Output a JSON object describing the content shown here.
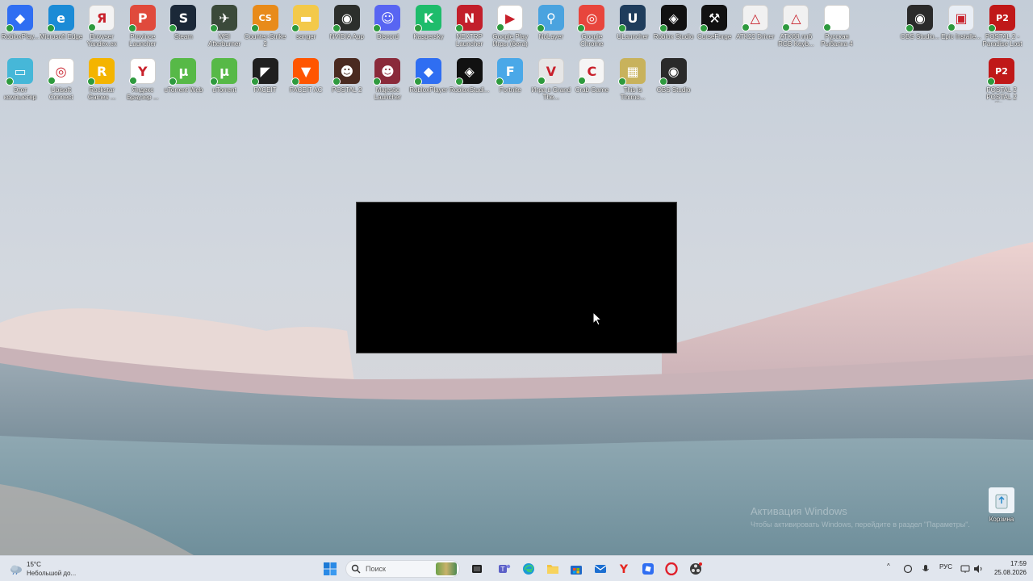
{
  "desktop": {
    "row1": [
      {
        "label": "RobloxPlay...",
        "icon": "roblox-player-icon",
        "color": "#2f6ef2",
        "glyph": "◆"
      },
      {
        "label": "Microsoft Edge",
        "icon": "edge-icon",
        "color": "#1b8bd6",
        "glyph": "e"
      },
      {
        "label": "Browser Yandex.ex",
        "icon": "yandex-browser-icon",
        "color": "#f3f3f3",
        "glyph": "Я"
      },
      {
        "label": "Province Launcher",
        "icon": "province-launcher-icon",
        "color": "#e04a3c",
        "glyph": "P"
      },
      {
        "label": "Steam",
        "icon": "steam-icon",
        "color": "#1b2838",
        "glyph": "S"
      },
      {
        "label": "MSI Afterburner",
        "icon": "msi-afterburner-icon",
        "color": "#3b4a3a",
        "glyph": "✈"
      },
      {
        "label": "Counter-Strike 2",
        "icon": "counter-strike-icon",
        "color": "#e88b1a",
        "glyph": "CS"
      },
      {
        "label": "sanger",
        "icon": "folder-icon",
        "color": "#f3c94a",
        "glyph": "▬"
      },
      {
        "label": "NVIDIA App",
        "icon": "nvidia-icon",
        "color": "#2c2f2c",
        "glyph": "◉"
      },
      {
        "label": "Discord",
        "icon": "discord-icon",
        "color": "#5865f2",
        "glyph": "☺"
      },
      {
        "label": "Kaspersky",
        "icon": "kaspersky-icon",
        "color": "#1ebc6b",
        "glyph": "K"
      },
      {
        "label": "NEXTRP Launcher",
        "icon": "nextrp-icon",
        "color": "#c21f2b",
        "glyph": "N"
      },
      {
        "label": "Google Play Игры (бета)",
        "icon": "google-play-icon",
        "color": "#ffffff",
        "glyph": "▶"
      },
      {
        "label": "NoLayer",
        "icon": "nolayer-icon",
        "color": "#4aa3df",
        "glyph": "⚲"
      },
      {
        "label": "Google Chrome",
        "icon": "chrome-icon",
        "color": "#e8453c",
        "glyph": "◎"
      },
      {
        "label": "ULauncher",
        "icon": "ulauncher-icon",
        "color": "#1f3d5c",
        "glyph": "U"
      },
      {
        "label": "Roblox Studio",
        "icon": "roblox-studio-icon",
        "color": "#111111",
        "glyph": "◈"
      },
      {
        "label": "CurseForge",
        "icon": "curseforge-icon",
        "color": "#111111",
        "glyph": "⚒"
      },
      {
        "label": "ATK22 Driver",
        "icon": "atk-driver-icon",
        "color": "#f1f1f1",
        "glyph": "△"
      },
      {
        "label": "ATK68 лпб RGB Keyb...",
        "icon": "atk-keyboard-icon",
        "color": "#f1f1f1",
        "glyph": "△"
      },
      {
        "label": "Русская Рыбалка 4",
        "icon": "document-icon",
        "color": "#ffffff",
        "glyph": ""
      }
    ],
    "row1_right": [
      {
        "label": "OBS Studio...",
        "icon": "obs-studio-icon",
        "color": "#2a2a2a",
        "glyph": "◉"
      },
      {
        "label": "Epic Installe...",
        "icon": "epic-installer-icon",
        "color": "#e9eef5",
        "glyph": "▣"
      },
      {
        "label": "POSTAL 2 - Paradise Lost",
        "icon": "postal2-paradise-icon",
        "color": "#c01818",
        "glyph": "P2"
      }
    ],
    "row2": [
      {
        "label": "Этот компьютер",
        "icon": "this-pc-icon",
        "color": "#46b7d8",
        "glyph": "▭"
      },
      {
        "label": "Ubisoft Connect",
        "icon": "ubisoft-icon",
        "color": "#ffffff",
        "glyph": "◎"
      },
      {
        "label": "Rockstar Games ...",
        "icon": "rockstar-icon",
        "color": "#f4b400",
        "glyph": "R"
      },
      {
        "label": "Яндекс Браузер ...",
        "icon": "yandex-icon",
        "color": "#ffffff",
        "glyph": "Y"
      },
      {
        "label": "uTorrent Web",
        "icon": "utorrent-web-icon",
        "color": "#57b947",
        "glyph": "μ"
      },
      {
        "label": "uTorrent",
        "icon": "utorrent-icon",
        "color": "#57b947",
        "glyph": "μ"
      },
      {
        "label": "FACEIT",
        "icon": "faceit-icon",
        "color": "#1f1f1f",
        "glyph": "◤"
      },
      {
        "label": "FACEIT AC",
        "icon": "faceit-ac-icon",
        "color": "#ff5500",
        "glyph": "▼"
      },
      {
        "label": "POSTAL 2",
        "icon": "postal2-icon",
        "color": "#4a2a20",
        "glyph": "☻"
      },
      {
        "label": "Majestic Launcher",
        "icon": "majestic-icon",
        "color": "#8a2a3a",
        "glyph": "☻"
      },
      {
        "label": "RobloxPlayer",
        "icon": "roblox-player-2-icon",
        "color": "#2f6ef2",
        "glyph": "◆"
      },
      {
        "label": "RobloxStudi...",
        "icon": "roblox-studio-2-icon",
        "color": "#111111",
        "glyph": "◈"
      },
      {
        "label": "Fortnite",
        "icon": "fortnite-icon",
        "color": "#4aa8e8",
        "glyph": "F"
      },
      {
        "label": "Игра в Grand The...",
        "icon": "gta-icon",
        "color": "#e6e6e6",
        "glyph": "V"
      },
      {
        "label": "Crab Game",
        "icon": "crab-game-icon",
        "color": "#f5f5f5",
        "glyph": "C"
      },
      {
        "label": "This is Timmo...",
        "icon": "timmo-icon",
        "color": "#c8b25c",
        "glyph": "▦"
      },
      {
        "label": "OBS Studio",
        "icon": "obs-icon",
        "color": "#2a2a2a",
        "glyph": "◉"
      }
    ],
    "row2_right": [
      {
        "label": "POSTAL 2 POSTAL 2 Ко...",
        "icon": "postal2-complete-icon",
        "color": "#c01818",
        "glyph": "P2"
      }
    ],
    "recycle_bin": {
      "label": "Корзина",
      "icon": "recycle-bin-icon"
    }
  },
  "watermark": {
    "title": "Активация Windows",
    "subtitle": "Чтобы активировать Windows, перейдите в раздел \"Параметры\"."
  },
  "taskbar": {
    "weather": {
      "temp": "15°C",
      "condition": "Небольшой до..."
    },
    "search_placeholder": "Поиск",
    "apps": [
      "start-button",
      "search-icon",
      "task-view-icon",
      "teams-icon",
      "edge-icon",
      "explorer-icon",
      "store-icon",
      "mail-icon",
      "yandex-icon",
      "roblox-icon",
      "opera-icon",
      "obs-icon"
    ],
    "tray": {
      "language": "РУС"
    },
    "clock": {
      "time": "17:59",
      "date": "25.08.2026"
    }
  }
}
